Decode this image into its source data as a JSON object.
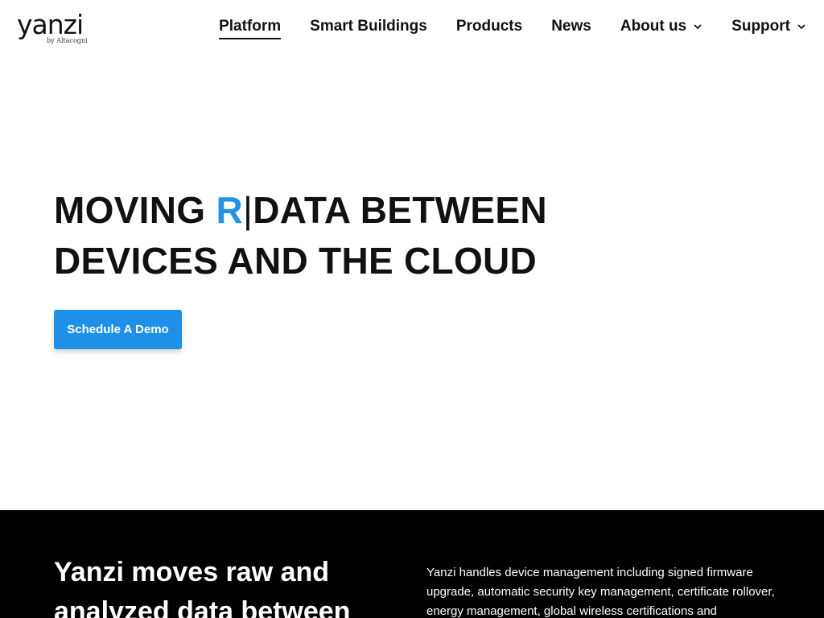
{
  "logo": {
    "word": "yanzi",
    "sub": "by Altacogni"
  },
  "nav": {
    "items": [
      {
        "label": "Platform",
        "active": true,
        "dropdown": false
      },
      {
        "label": "Smart Buildings",
        "active": false,
        "dropdown": false
      },
      {
        "label": "Products",
        "active": false,
        "dropdown": false
      },
      {
        "label": "News",
        "active": false,
        "dropdown": false
      },
      {
        "label": "About us",
        "active": false,
        "dropdown": true,
        "icon": "chevron-down-icon"
      },
      {
        "label": "Support",
        "active": false,
        "dropdown": true,
        "icon": "chevron-down-icon"
      }
    ]
  },
  "hero": {
    "title_part1": "MOVING ",
    "title_typed": "R",
    "title_cursor": "|",
    "title_part2": "DATA BETWEEN DEVICES AND THE CLOUD",
    "cta_label": "Schedule A Demo"
  },
  "section": {
    "heading": "Yanzi moves raw and analyzed data between",
    "body": "Yanzi handles device management including signed firmware upgrade, automatic security key management, certificate rollover, energy management, global wireless certifications and"
  },
  "colors": {
    "accent": "#2493e6",
    "button": "#1f90e8",
    "dark_bg": "#000000",
    "text": "#111111"
  }
}
